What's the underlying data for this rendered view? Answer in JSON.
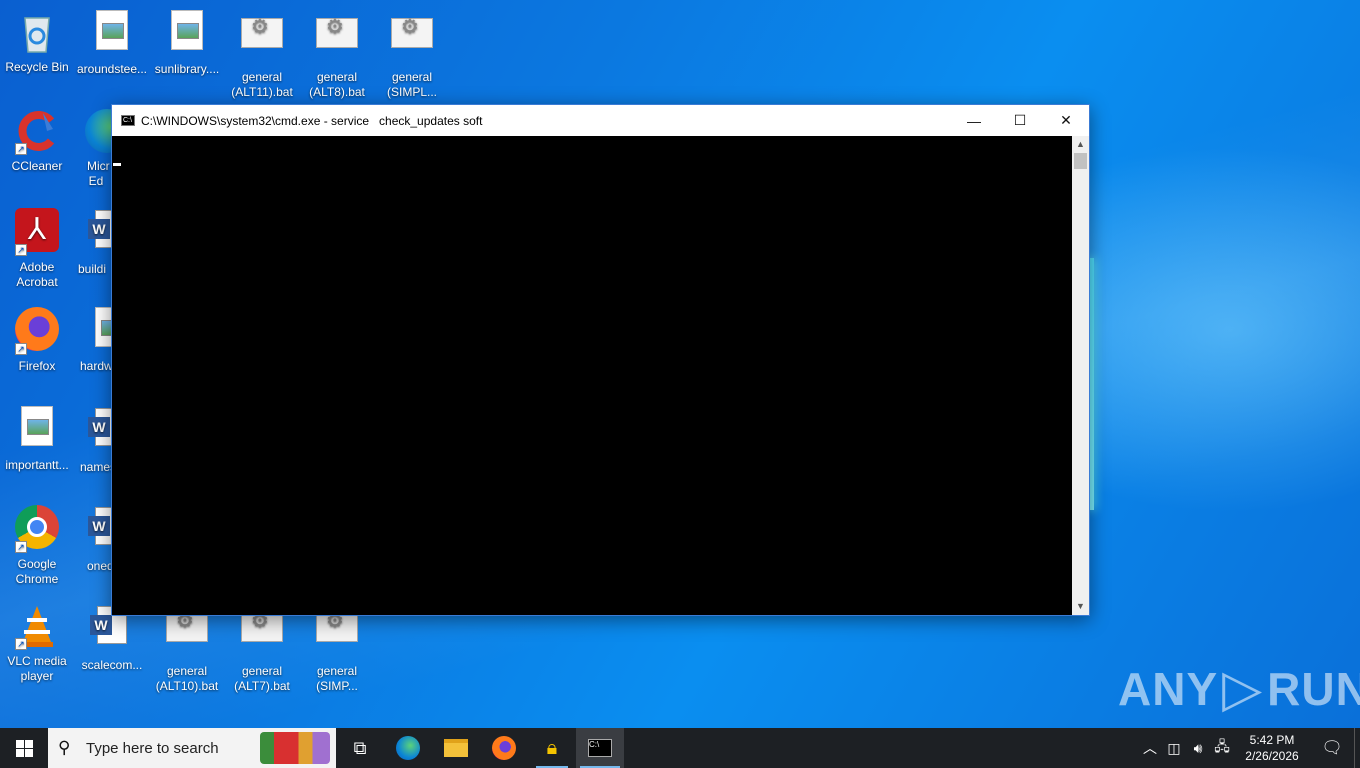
{
  "desktop": {
    "icons": [
      {
        "label": "Recycle Bin"
      },
      {
        "label": "aroundstee..."
      },
      {
        "label": "sunlibrary...."
      },
      {
        "label": "general (ALT11).bat"
      },
      {
        "label": "general (ALT8).bat"
      },
      {
        "label": "general (SIMPL..."
      },
      {
        "label": "CCleaner"
      },
      {
        "label": "Micr Ed"
      },
      {
        "label": "Adobe Acrobat"
      },
      {
        "label": "buildi"
      },
      {
        "label": "Firefox"
      },
      {
        "label": "hardw"
      },
      {
        "label": "importantt..."
      },
      {
        "label": "names"
      },
      {
        "label": "Google Chrome"
      },
      {
        "label": "oned"
      },
      {
        "label": "VLC media player"
      },
      {
        "label": "scalecom..."
      },
      {
        "label": "general (ALT10).bat"
      },
      {
        "label": "general (ALT7).bat"
      },
      {
        "label": "general (SIMP..."
      }
    ]
  },
  "cmd_window": {
    "title": "C:\\WINDOWS\\system32\\cmd.exe - service   check_updates soft",
    "icon": "cmd-icon",
    "minimize": "—",
    "maximize": "☐",
    "close": "✕"
  },
  "watermark": {
    "left": "ANY",
    "right": "RUN"
  },
  "taskbar": {
    "search_placeholder": "Type here to search",
    "apps": [
      "task-view-icon",
      "edge-icon",
      "file-explorer-icon",
      "firefox-icon",
      "lock-app-icon",
      "cmd-icon"
    ],
    "clock_time": "5:42 PM",
    "clock_date": "2/26/2026"
  },
  "colors": {
    "taskbar": "#1d2024",
    "accent": "#76b9ed",
    "desktop": "#0b78e0"
  }
}
